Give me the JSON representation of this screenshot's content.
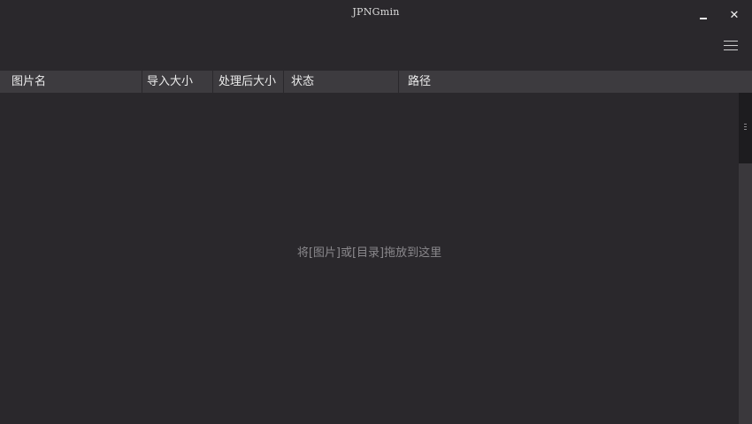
{
  "window": {
    "title": "JPNGmin",
    "close_glyph": "✕"
  },
  "columns": [
    {
      "label": "图片名"
    },
    {
      "label": "导入大小"
    },
    {
      "label": "处理后大小"
    },
    {
      "label": "状态"
    },
    {
      "label": "路径"
    }
  ],
  "content": {
    "empty_hint": "将[图片]或[目录]拖放到这里"
  },
  "icons": {
    "minimize": "minimize-icon",
    "close": "close-icon",
    "menu": "hamburger-menu-icon"
  },
  "colors": {
    "background": "#2a282c",
    "header": "#3d3b3f",
    "hint_text": "#8a888c"
  }
}
